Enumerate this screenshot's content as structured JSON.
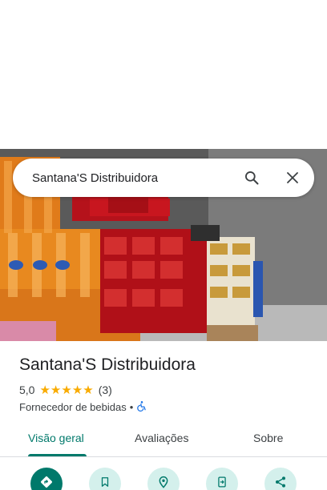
{
  "search": {
    "query": "Santana'S Distribuidora"
  },
  "place": {
    "name": "Santana'S Distribuidora",
    "rating": "5,0",
    "stars": 5,
    "review_count": "(3)",
    "category": "Fornecedor de bebidas",
    "separator": "•"
  },
  "tabs": [
    {
      "label": "Visão geral",
      "active": true
    },
    {
      "label": "Avaliações",
      "active": false
    },
    {
      "label": "Sobre",
      "active": false
    }
  ],
  "actions": [
    {
      "icon": "directions-icon"
    },
    {
      "icon": "bookmark-icon"
    },
    {
      "icon": "nearby-icon"
    },
    {
      "icon": "send-to-phone-icon"
    },
    {
      "icon": "share-icon"
    }
  ],
  "colors": {
    "accent": "#00796b",
    "star": "#f9ab00",
    "action_bg": "#d4f0ec"
  }
}
